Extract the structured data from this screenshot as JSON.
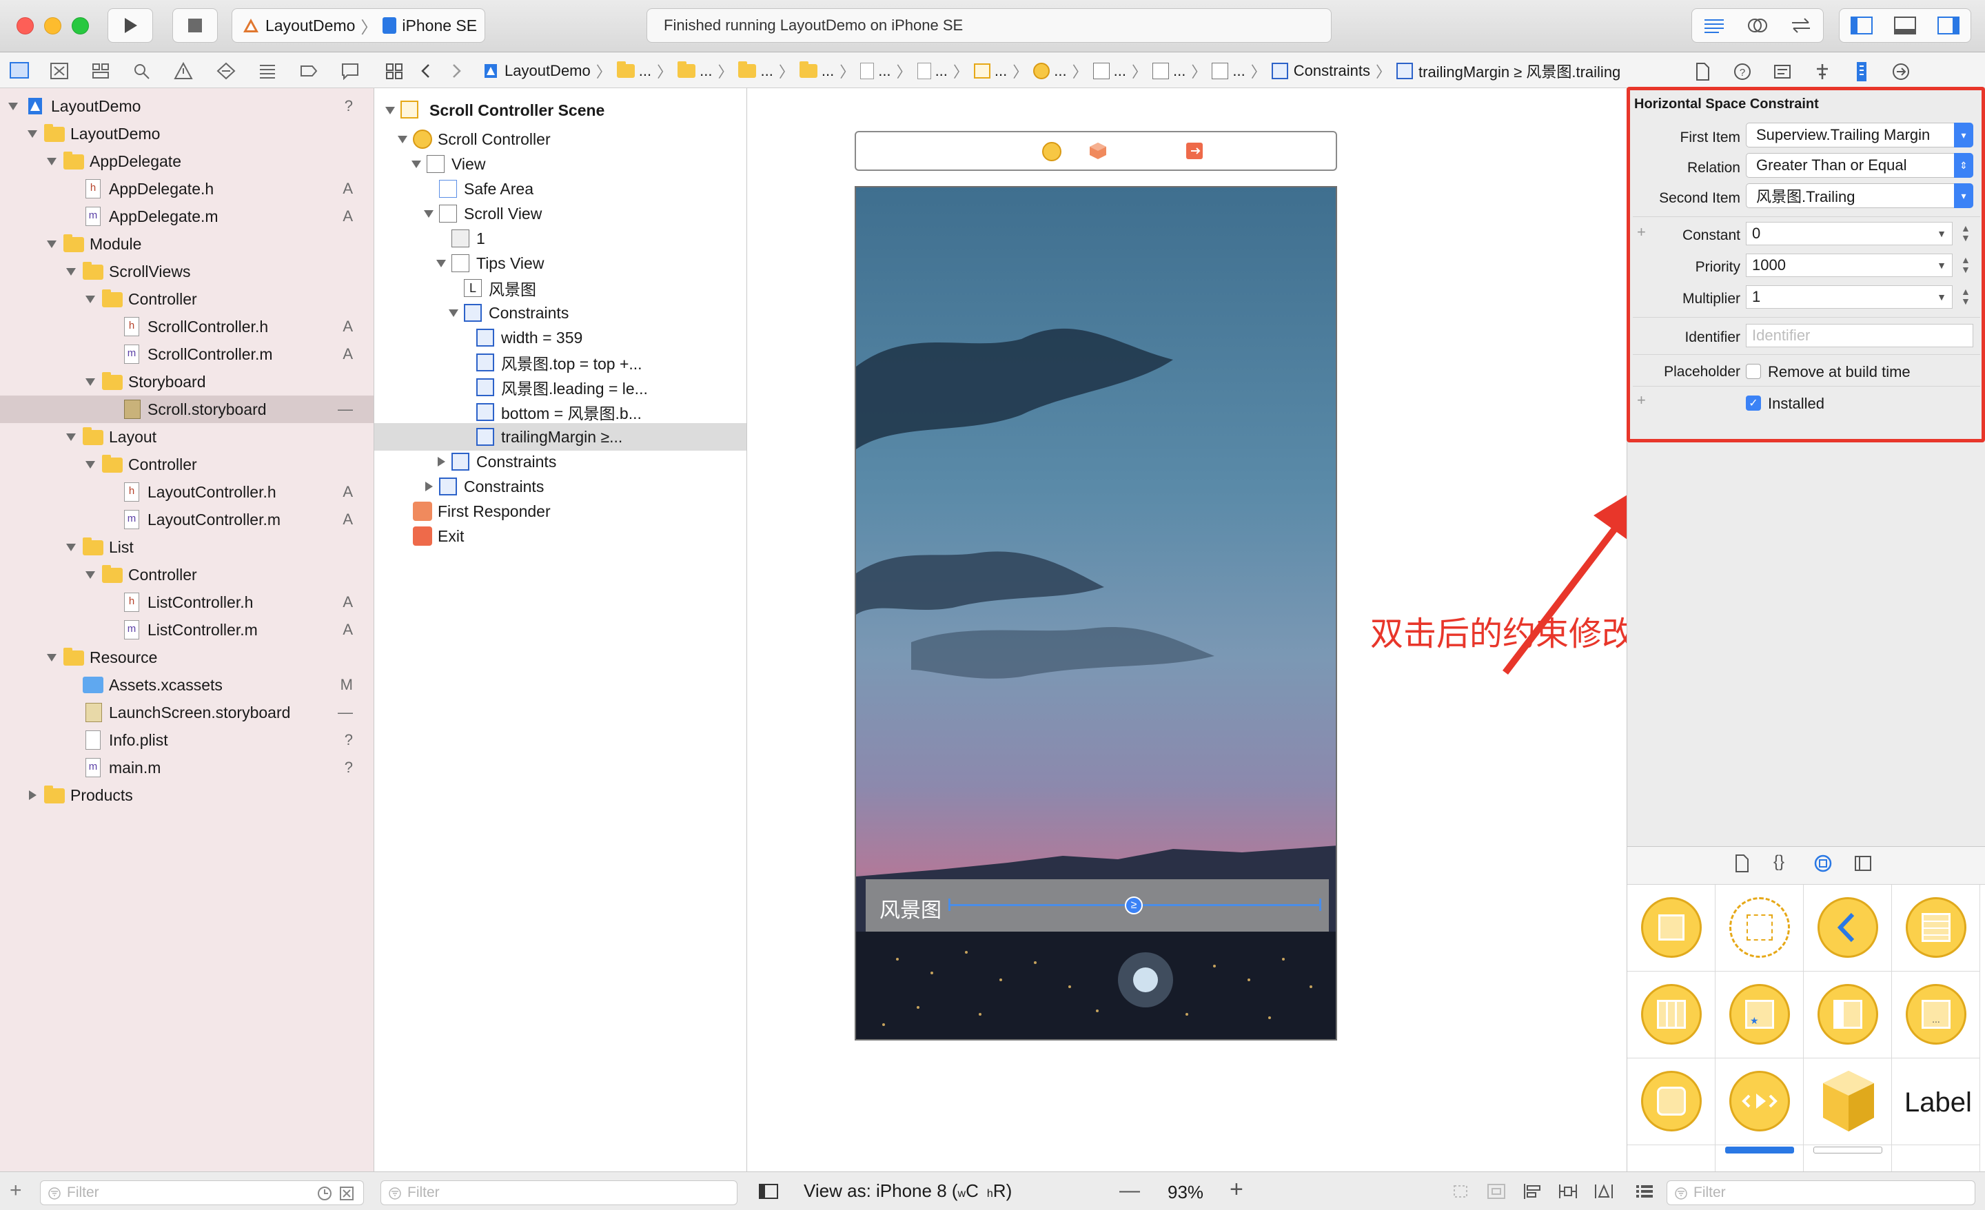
{
  "toolbar": {
    "scheme_target": "LayoutDemo",
    "device": "iPhone SE",
    "activity_status": "Finished running LayoutDemo on iPhone SE"
  },
  "jumpbar": {
    "project": "LayoutDemo",
    "ellipsis": "...",
    "constraints": "Constraints",
    "current": "trailingMargin ≥ 风景图.trailing"
  },
  "navigator": {
    "items": [
      {
        "label": "LayoutDemo",
        "status": "?"
      },
      {
        "label": "LayoutDemo",
        "status": ""
      },
      {
        "label": "AppDelegate",
        "status": ""
      },
      {
        "label": "AppDelegate.h",
        "status": "A",
        "badge": "h"
      },
      {
        "label": "AppDelegate.m",
        "status": "A",
        "badge": "m"
      },
      {
        "label": "Module",
        "status": ""
      },
      {
        "label": "ScrollViews",
        "status": ""
      },
      {
        "label": "Controller",
        "status": ""
      },
      {
        "label": "ScrollController.h",
        "status": "A",
        "badge": "h"
      },
      {
        "label": "ScrollController.m",
        "status": "A",
        "badge": "m"
      },
      {
        "label": "Storyboard",
        "status": ""
      },
      {
        "label": "Scroll.storyboard",
        "status": "—"
      },
      {
        "label": "Layout",
        "status": ""
      },
      {
        "label": "Controller",
        "status": ""
      },
      {
        "label": "LayoutController.h",
        "status": "A",
        "badge": "h"
      },
      {
        "label": "LayoutController.m",
        "status": "A",
        "badge": "m"
      },
      {
        "label": "List",
        "status": ""
      },
      {
        "label": "Controller",
        "status": ""
      },
      {
        "label": "ListController.h",
        "status": "A",
        "badge": "h"
      },
      {
        "label": "ListController.m",
        "status": "A",
        "badge": "m"
      },
      {
        "label": "Resource",
        "status": ""
      },
      {
        "label": "Assets.xcassets",
        "status": "M"
      },
      {
        "label": "LaunchScreen.storyboard",
        "status": "—"
      },
      {
        "label": "Info.plist",
        "status": "?"
      },
      {
        "label": "main.m",
        "status": "?",
        "badge": "m"
      },
      {
        "label": "Products",
        "status": ""
      }
    ],
    "filter_placeholder": "Filter"
  },
  "outline": {
    "items": [
      {
        "label": "Scroll Controller Scene"
      },
      {
        "label": "Scroll Controller"
      },
      {
        "label": "View"
      },
      {
        "label": "Safe Area"
      },
      {
        "label": "Scroll View"
      },
      {
        "label": "1"
      },
      {
        "label": "Tips View"
      },
      {
        "label": "风景图",
        "badge": "L"
      },
      {
        "label": "Constraints"
      },
      {
        "label": "width = 359"
      },
      {
        "label": "风景图.top = top +..."
      },
      {
        "label": "风景图.leading = le..."
      },
      {
        "label": "bottom = 风景图.b..."
      },
      {
        "label": "trailingMargin ≥..."
      },
      {
        "label": "Constraints"
      },
      {
        "label": "Constraints"
      },
      {
        "label": "First Responder"
      },
      {
        "label": "Exit"
      }
    ],
    "filter_placeholder": "Filter"
  },
  "canvas": {
    "label_text": "风景图",
    "relation_symbol": "≥",
    "view_as": "View as: iPhone 8 (",
    "size_class_w": "w",
    "size_class_c": "C",
    "size_class_h": "h",
    "size_class_r": "R)",
    "zoom": "93%",
    "annotation": "双击后的约束修改界面",
    "annotation_color": "#e8362a"
  },
  "inspector": {
    "title": "Horizontal Space Constraint",
    "first_item_label": "First Item",
    "first_item_value": "Superview.Trailing Margin",
    "relation_label": "Relation",
    "relation_value": "Greater Than or Equal",
    "second_item_label": "Second Item",
    "second_item_value": "风景图.Trailing",
    "constant_label": "Constant",
    "constant_value": "0",
    "priority_label": "Priority",
    "priority_value": "1000",
    "multiplier_label": "Multiplier",
    "multiplier_value": "1",
    "identifier_label": "Identifier",
    "identifier_placeholder": "Identifier",
    "placeholder_label": "Placeholder",
    "remove_at_build": "Remove at build time",
    "installed": "Installed",
    "installed_checked": true,
    "highlight_color": "#e8362a"
  },
  "library": {
    "label_item": "Label",
    "filter_placeholder": "Filter"
  }
}
